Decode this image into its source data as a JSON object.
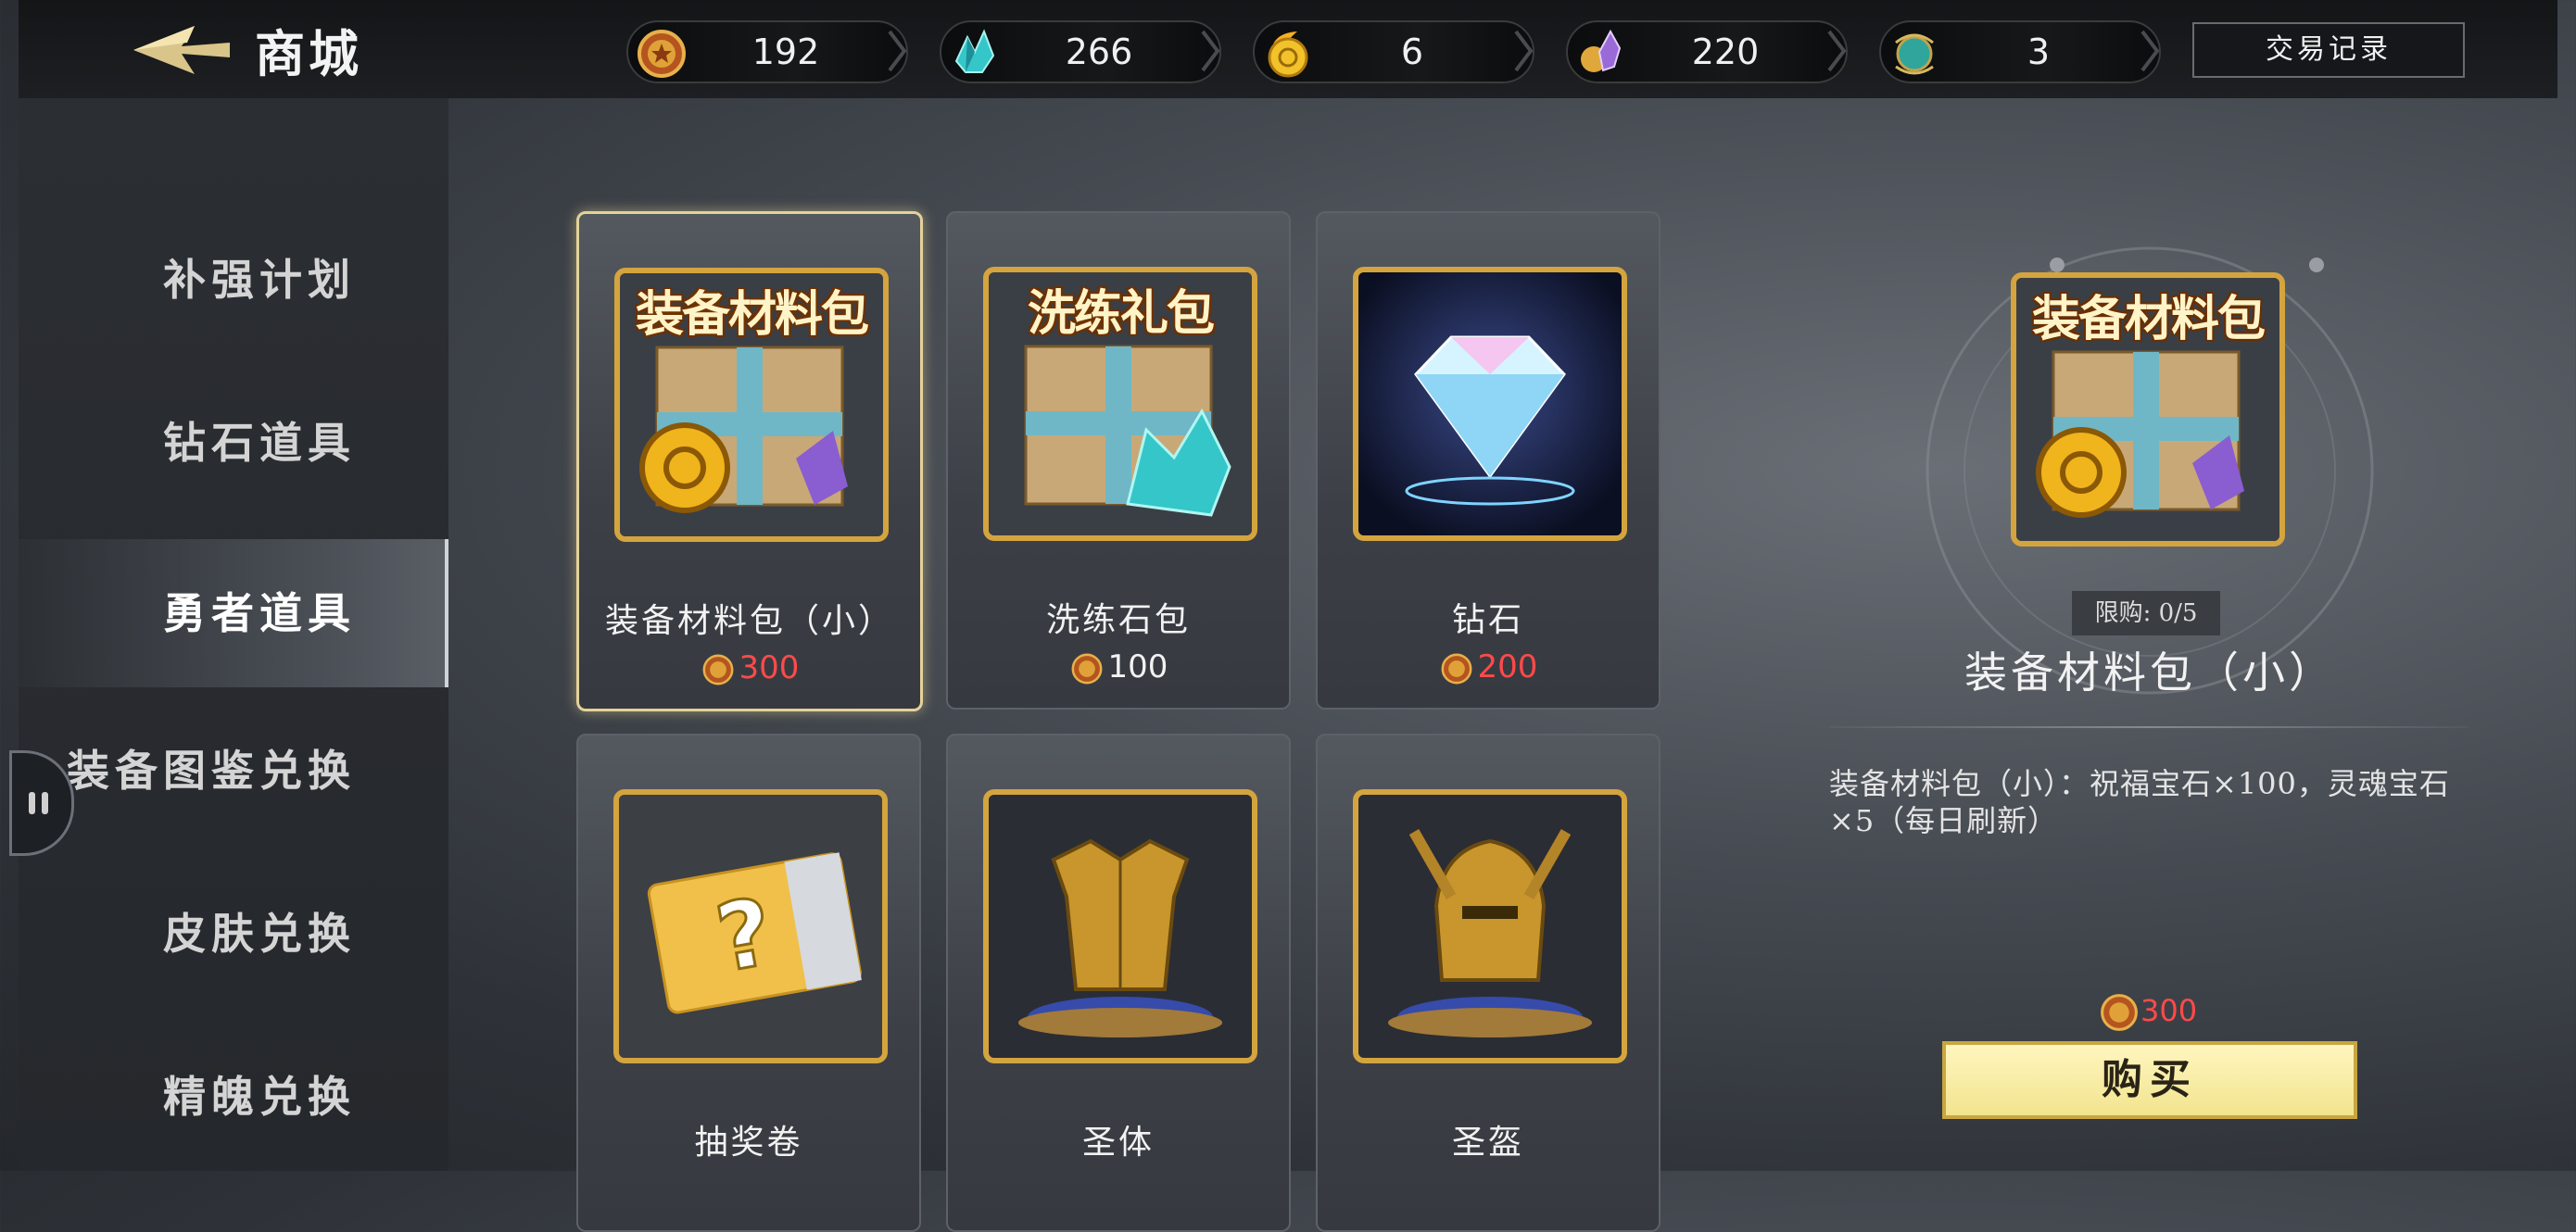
{
  "header": {
    "title": "商城",
    "back_icon": "back-arrow-icon",
    "trade_record_label": "交易记录",
    "currencies": [
      {
        "icon": "medal-coin-icon",
        "value": "192"
      },
      {
        "icon": "crystal-icon",
        "value": "266"
      },
      {
        "icon": "gold-coin-icon",
        "value": "6"
      },
      {
        "icon": "soul-crystal-icon",
        "value": "220"
      },
      {
        "icon": "jade-orb-icon",
        "value": "3"
      }
    ]
  },
  "sidebar": {
    "items": [
      {
        "label": "补强计划",
        "active": false
      },
      {
        "label": "钻石道具",
        "active": false
      },
      {
        "label": "勇者道具",
        "active": true
      },
      {
        "label": "装备图鉴兑换",
        "active": false
      },
      {
        "label": "皮肤兑换",
        "active": false
      },
      {
        "label": "精魄兑换",
        "active": false
      }
    ]
  },
  "items": [
    {
      "name": "装备材料包（小）",
      "image_text": "装备材料包",
      "icon": "equipment-material-pack-icon",
      "price": "300",
      "price_color": "#ff4a4a",
      "selected": true
    },
    {
      "name": "洗练石包",
      "image_text": "洗练礼包",
      "icon": "refining-gift-pack-icon",
      "price": "100",
      "price_color": "#f2f2f2",
      "selected": false
    },
    {
      "name": "钻石",
      "image_text": "",
      "icon": "diamond-icon",
      "price": "200",
      "price_color": "#ff4a4a",
      "selected": false
    },
    {
      "name": "抽奖卷",
      "image_text": "",
      "icon": "lottery-ticket-icon",
      "price": "",
      "selected": false
    },
    {
      "name": "圣体",
      "image_text": "",
      "icon": "holy-armor-icon",
      "price": "",
      "selected": false
    },
    {
      "name": "圣盔",
      "image_text": "",
      "icon": "holy-helmet-icon",
      "price": "",
      "selected": false
    }
  ],
  "detail": {
    "image_text": "装备材料包",
    "limit": "限购: 0/5",
    "name": "装备材料包（小）",
    "description": "装备材料包（小）：祝福宝石×100，灵魂宝石×5（每日刷新）",
    "price": "300",
    "buy_label": "购买"
  },
  "colors": {
    "accent_gold": "#d4a43e",
    "price_red": "#ff4a4a",
    "buy_button": "#f2e48e"
  }
}
